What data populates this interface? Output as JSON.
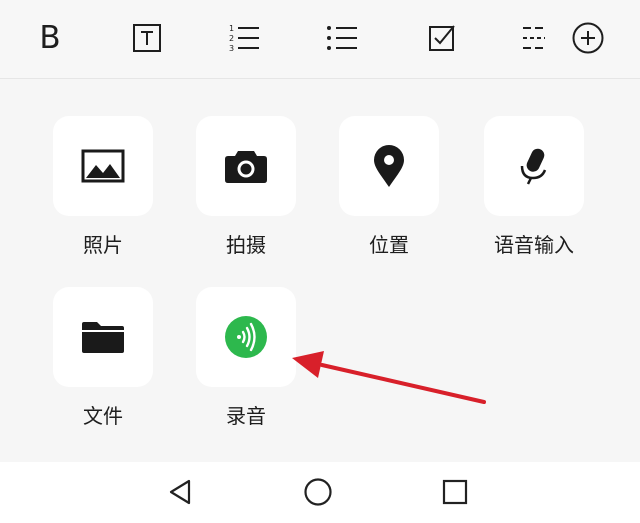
{
  "toolbar": {
    "bold_label": "B",
    "items": [
      "bold-icon",
      "text-style-icon",
      "numbered-list-icon",
      "bulleted-list-icon",
      "checkbox-icon",
      "divider-icon",
      "add-circle-icon"
    ]
  },
  "attachments": [
    {
      "label": "照片",
      "icon": "photo-icon"
    },
    {
      "label": "拍摄",
      "icon": "camera-icon"
    },
    {
      "label": "位置",
      "icon": "location-pin-icon"
    },
    {
      "label": "语音输入",
      "icon": "microphone-icon"
    },
    {
      "label": "文件",
      "icon": "folder-icon"
    },
    {
      "label": "录音",
      "icon": "voice-recording-icon"
    }
  ],
  "navigation": {
    "items": [
      "back-triangle-icon",
      "home-circle-icon",
      "recents-square-icon"
    ]
  },
  "colors": {
    "recording_accent": "#2db84d",
    "annotation_arrow": "#d8202a"
  }
}
